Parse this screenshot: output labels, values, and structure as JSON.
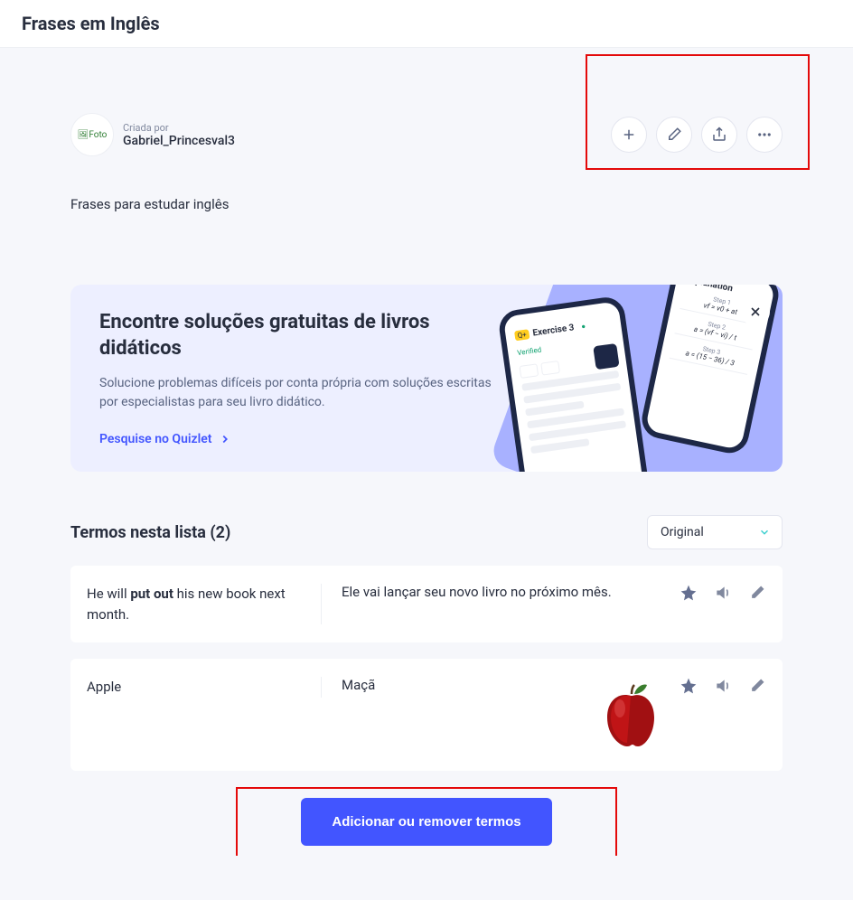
{
  "header": {
    "title": "Frases em Inglês"
  },
  "creator": {
    "avatar_alt": "Foto",
    "by_label": "Criada por",
    "name": "Gabriel_Princesval3"
  },
  "description": "Frases para estudar inglês",
  "promo": {
    "title": "Encontre soluções gratuitas de livros didáticos",
    "body": "Solucione problemas difíceis por conta própria com soluções escritas por especialistas para seu livro didático.",
    "link_label": "Pesquise no Quizlet",
    "phone1_title": "Exercise 3",
    "phone1_badge": "Verified",
    "phone2_title": "Explanation",
    "step1": "Step 1",
    "step2": "Step 2",
    "step3": "Step 3",
    "formula1": "vf = v0 + at",
    "formula2": "a = (vf − vi) / t",
    "formula3": "a = (15 − 36) / 3"
  },
  "terms_section": {
    "heading": "Termos nesta lista (2)",
    "sort_label": "Original"
  },
  "terms": [
    {
      "term_pre": "He will ",
      "term_bold": "put out",
      "term_post": " his new book next month.",
      "definition": "Ele vai lançar seu novo livro no próximo mês.",
      "has_image": false
    },
    {
      "term_pre": "Apple",
      "term_bold": "",
      "term_post": "",
      "definition": "Maçã",
      "has_image": true
    }
  ],
  "footer": {
    "add_remove_label": "Adicionar ou remover termos"
  }
}
